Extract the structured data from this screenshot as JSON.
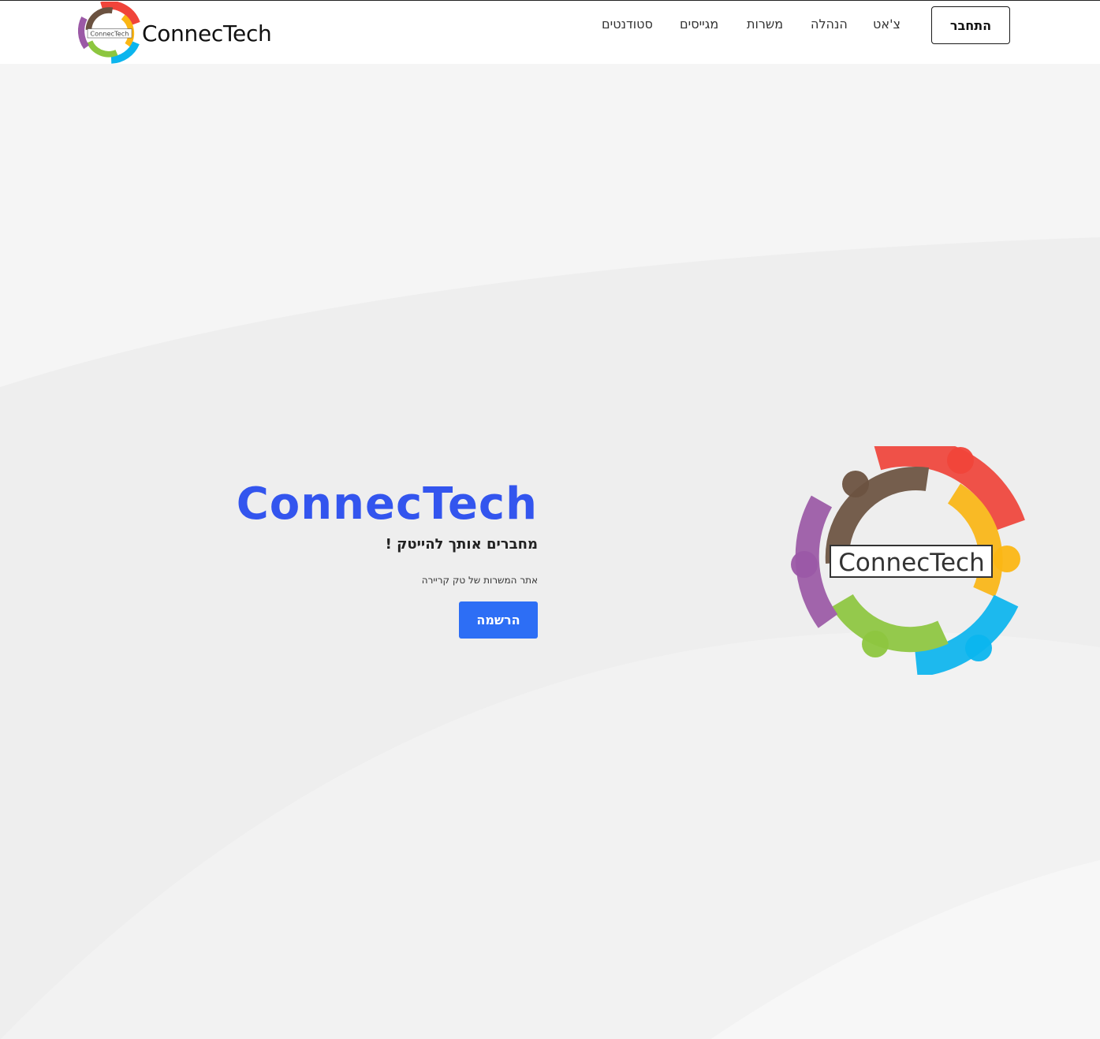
{
  "header": {
    "brand_name": "ConnecTech",
    "logo_text": "ConnecTech",
    "nav": [
      {
        "label": "צ'אט"
      },
      {
        "label": "הנהלה"
      },
      {
        "label": "משרות"
      },
      {
        "label": "מגייסים"
      },
      {
        "label": "סטודנטים"
      }
    ],
    "connect_label": "התחבר"
  },
  "hero": {
    "title": "ConnecTech",
    "subtitle": "מחברים אותך להייטק !",
    "description": "אתר המשרות של טק קריירה",
    "signup_label": "הרשמה",
    "logo_text": "ConnecTech"
  },
  "colors": {
    "accent": "#3355ee",
    "button": "#2d6ef5",
    "ring_red": "#f0443a",
    "ring_yellow": "#fbb614",
    "ring_blue": "#0bb5ee",
    "ring_green": "#8dc63f",
    "ring_purple": "#9b59a6",
    "ring_brown": "#6b5240"
  }
}
